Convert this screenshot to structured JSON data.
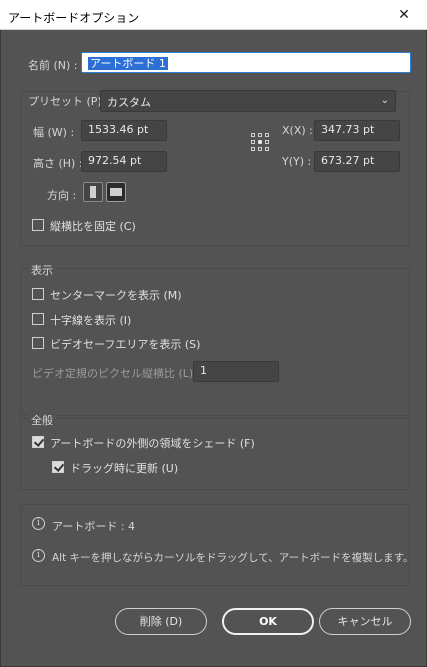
{
  "window": {
    "title": "アートボードオプション",
    "close_glyph": "✕"
  },
  "name": {
    "label": "名前 (N) :",
    "value": "アートボード 1"
  },
  "preset": {
    "label": "プリセット (P) :",
    "value": "カスタム"
  },
  "width": {
    "label": "幅 (W) :",
    "value": "1533.46 pt"
  },
  "height": {
    "label": "高さ (H) :",
    "value": "972.54 pt"
  },
  "x": {
    "label": "X(X) :",
    "value": "347.73 pt"
  },
  "y": {
    "label": "Y(Y) :",
    "value": "673.27 pt"
  },
  "orientation": {
    "label": "方向 :"
  },
  "constrain": {
    "label": "縦横比を固定 (C)",
    "checked": false
  },
  "display": {
    "title": "表示",
    "center_mark": {
      "label": "センターマークを表示 (M)",
      "checked": false
    },
    "cross_hairs": {
      "label": "十字線を表示 (I)",
      "checked": false
    },
    "video_safe": {
      "label": "ビデオセーフエリアを表示 (S)",
      "checked": false
    },
    "pixel_aspect": {
      "label": "ビデオ定規のピクセル縦横比 (L) :",
      "value": "1"
    }
  },
  "global": {
    "title": "全般",
    "fade": {
      "label": "アートボードの外側の領域をシェード (F)",
      "checked": true
    },
    "update": {
      "label": "ドラッグ時に更新 (U)",
      "checked": true
    }
  },
  "info": {
    "count": "アートボード : 4",
    "tip": "Alt キーを押しながらカーソルをドラッグして、アートボードを複製します。"
  },
  "buttons": {
    "delete": "削除 (D)",
    "ok": "OK",
    "cancel": "キャンセル"
  }
}
